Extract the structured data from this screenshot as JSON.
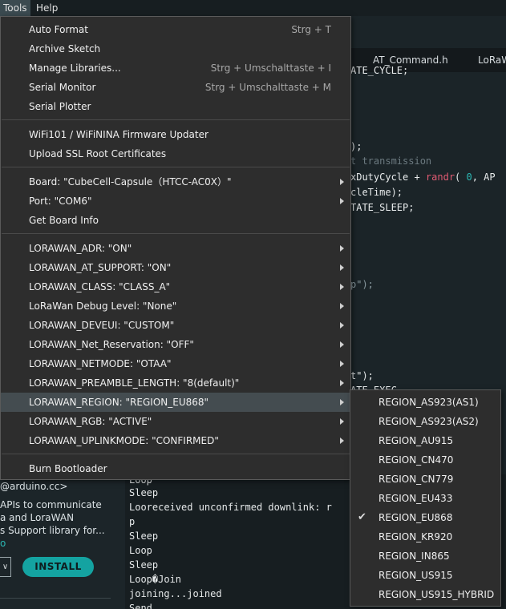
{
  "menubar": {
    "tools": "Tools",
    "help": "Help"
  },
  "tools_menu": {
    "auto_format": "Auto Format",
    "auto_format_sc": "Strg + T",
    "archive_sketch": "Archive Sketch",
    "manage_libraries": "Manage Libraries...",
    "manage_libraries_sc": "Strg + Umschalttaste + I",
    "serial_monitor": "Serial Monitor",
    "serial_monitor_sc": "Strg + Umschalttaste + M",
    "serial_plotter": "Serial Plotter",
    "wifi_updater": "WiFi101 / WiFiNINA Firmware Updater",
    "upload_ssl": "Upload SSL Root Certificates",
    "board": "Board: \"CubeCell-Capsule（HTCC-AC0X）\"",
    "port": "Port: \"COM6\"",
    "get_board_info": "Get Board Info",
    "lorawan_adr": "LORAWAN_ADR: \"ON\"",
    "lorawan_at_support": "LORAWAN_AT_SUPPORT: \"ON\"",
    "lorawan_class": "LORAWAN_CLASS: \"CLASS_A\"",
    "lorawan_debug": "LoRaWan Debug Level: \"None\"",
    "lorawan_deveui": "LORAWAN_DEVEUI: \"CUSTOM\"",
    "lorawan_net_res": "LORAWAN_Net_Reservation: \"OFF\"",
    "lorawan_netmode": "LORAWAN_NETMODE: \"OTAA\"",
    "lorawan_preamble": "LORAWAN_PREAMBLE_LENGTH: \"8(default)\"",
    "lorawan_region": "LORAWAN_REGION: \"REGION_EU868\"",
    "lorawan_rgb": "LORAWAN_RGB: \"ACTIVE\"",
    "lorawan_uplinkmode": "LORAWAN_UPLINKMODE: \"CONFIRMED\"",
    "burn_bootloader": "Burn Bootloader"
  },
  "region_submenu": {
    "items": [
      "REGION_AS923(AS1)",
      "REGION_AS923(AS2)",
      "REGION_AU915",
      "REGION_CN470",
      "REGION_CN779",
      "REGION_EU433",
      "REGION_EU868",
      "REGION_KR920",
      "REGION_IN865",
      "REGION_US915",
      "REGION_US915_HYBRID"
    ],
    "selected": "REGION_EU868",
    "check_glyph": "✔"
  },
  "editor": {
    "tabs": [
      "AT_Command.h",
      "LoRaW"
    ],
    "lines": {
      "l1": "ATE_CYCLE;",
      "l2": ");",
      "l3": "t transmission",
      "l4a": "xDutyCycle + ",
      "l4b": "randr",
      "l4c": "( ",
      "l4d": "0",
      "l4e": ", AP",
      "l5": "cleTime);",
      "l6": "TATE_SLEEP;",
      "l7": "p\");",
      "l8": "t\");",
      "l9": "ATE_EXEC"
    }
  },
  "library_panel": {
    "author": "@arduino.cc>",
    "desc1": "APIs to communicate",
    "desc2": "a and LoraWAN",
    "desc3": "s Support library for...",
    "more": "o",
    "install": "INSTALL",
    "dropdown": "∨"
  },
  "console": {
    "lines": [
      "Loop",
      "Sleep",
      "Looreceived unconfirmed downlink: r",
      "p",
      "Sleep",
      "Loop",
      "Sleep",
      "Loop�Join",
      "joining...joined",
      "Send"
    ]
  }
}
